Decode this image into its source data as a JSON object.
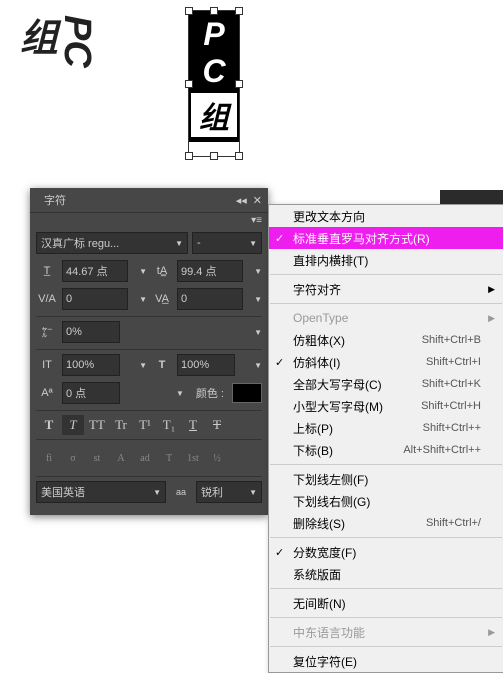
{
  "canvas": {
    "text_pc": "PC",
    "text_zu": "组"
  },
  "panel": {
    "title": "字符",
    "font_family": "汉真广标 regu...",
    "font_style": "-",
    "font_size": "44.67 点",
    "leading": "99.4 点",
    "kerning": "0",
    "tracking": "0",
    "baseline_shift": "0%",
    "vert_scale": "100%",
    "horz_scale": "100%",
    "baseline": "0 点",
    "color_label": "颜色 :",
    "language": "美国英语",
    "antialiasing": "锐利",
    "styles": {
      "bold": "T",
      "italic": "T",
      "allcaps": "TT",
      "smallcaps": "Tr",
      "superscript": "T¹",
      "subscript": "T₁",
      "underline": "T",
      "strike": "T"
    },
    "opentype": {
      "fi": "fi",
      "sigma": "σ",
      "st": "st",
      "script": "A",
      "aa": "ad",
      "titling": "T",
      "first": "1st",
      "half": "½"
    }
  },
  "menu": {
    "items": [
      {
        "label": "更改文本方向",
        "type": "item"
      },
      {
        "label": "标准垂直罗马对齐方式(R)",
        "type": "item",
        "checked": true,
        "highlighted": true
      },
      {
        "label": "直排内横排(T)",
        "type": "item"
      },
      {
        "type": "sep"
      },
      {
        "label": "字符对齐",
        "type": "submenu"
      },
      {
        "type": "sep"
      },
      {
        "label": "OpenType",
        "type": "submenu",
        "disabled": true
      },
      {
        "label": "仿粗体(X)",
        "shortcut": "Shift+Ctrl+B",
        "type": "item"
      },
      {
        "label": "仿斜体(I)",
        "shortcut": "Shift+Ctrl+I",
        "type": "item",
        "checked": true
      },
      {
        "label": "全部大写字母(C)",
        "shortcut": "Shift+Ctrl+K",
        "type": "item"
      },
      {
        "label": "小型大写字母(M)",
        "shortcut": "Shift+Ctrl+H",
        "type": "item"
      },
      {
        "label": "上标(P)",
        "shortcut": "Shift+Ctrl++",
        "type": "item"
      },
      {
        "label": "下标(B)",
        "shortcut": "Alt+Shift+Ctrl++",
        "type": "item"
      },
      {
        "type": "sep"
      },
      {
        "label": "下划线左侧(F)",
        "type": "item"
      },
      {
        "label": "下划线右侧(G)",
        "type": "item"
      },
      {
        "label": "删除线(S)",
        "shortcut": "Shift+Ctrl+/",
        "type": "item"
      },
      {
        "type": "sep"
      },
      {
        "label": "分数宽度(F)",
        "type": "item",
        "checked": true
      },
      {
        "label": "系统版面",
        "type": "item"
      },
      {
        "type": "sep"
      },
      {
        "label": "无间断(N)",
        "type": "item"
      },
      {
        "type": "sep"
      },
      {
        "label": "中东语言功能",
        "type": "submenu",
        "disabled": true
      },
      {
        "type": "sep"
      },
      {
        "label": "复位字符(E)",
        "type": "item"
      }
    ]
  }
}
